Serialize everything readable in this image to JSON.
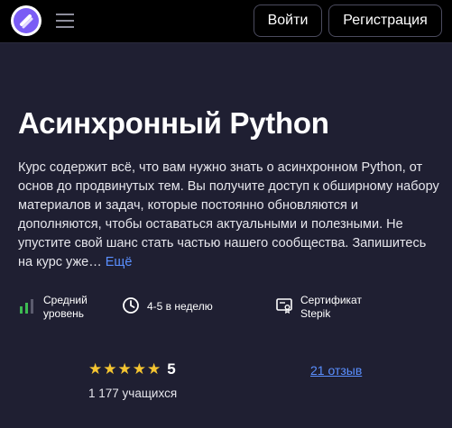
{
  "header": {
    "logo_icon": "stepik-logo",
    "menu_icon": "hamburger-menu-icon",
    "login_label": "Войти",
    "register_label": "Регистрация"
  },
  "course": {
    "title": "Асинхронный Python",
    "description": "Курс содержит всё, что вам нужно знать о асинхронном Python, от основ до продвинутых тем. Вы получите доступ к обширному набору материалов и задач, которые постоянно обновляются и дополняются, чтобы оставаться актуальными и полезными. Не упустите свой шанс стать частью нашего сообщества. Запишитесь на курс уже…",
    "more_label": "Ещё"
  },
  "features": {
    "level_line1": "Средний",
    "level_line2": "уровень",
    "time": "4-5 в неделю",
    "cert_line1": "Сертификат",
    "cert_line2": "Stepik"
  },
  "stats": {
    "stars": "★★★★★",
    "rating": "5",
    "learners": "1 177 учащихся",
    "reviews": "21 отзыв"
  },
  "colors": {
    "background": "#1f1f32",
    "topbar": "#000000",
    "link": "#5a8fff",
    "star": "#f5c531",
    "level_bar": "#3dbb52",
    "logo": "#7a5cf5"
  }
}
